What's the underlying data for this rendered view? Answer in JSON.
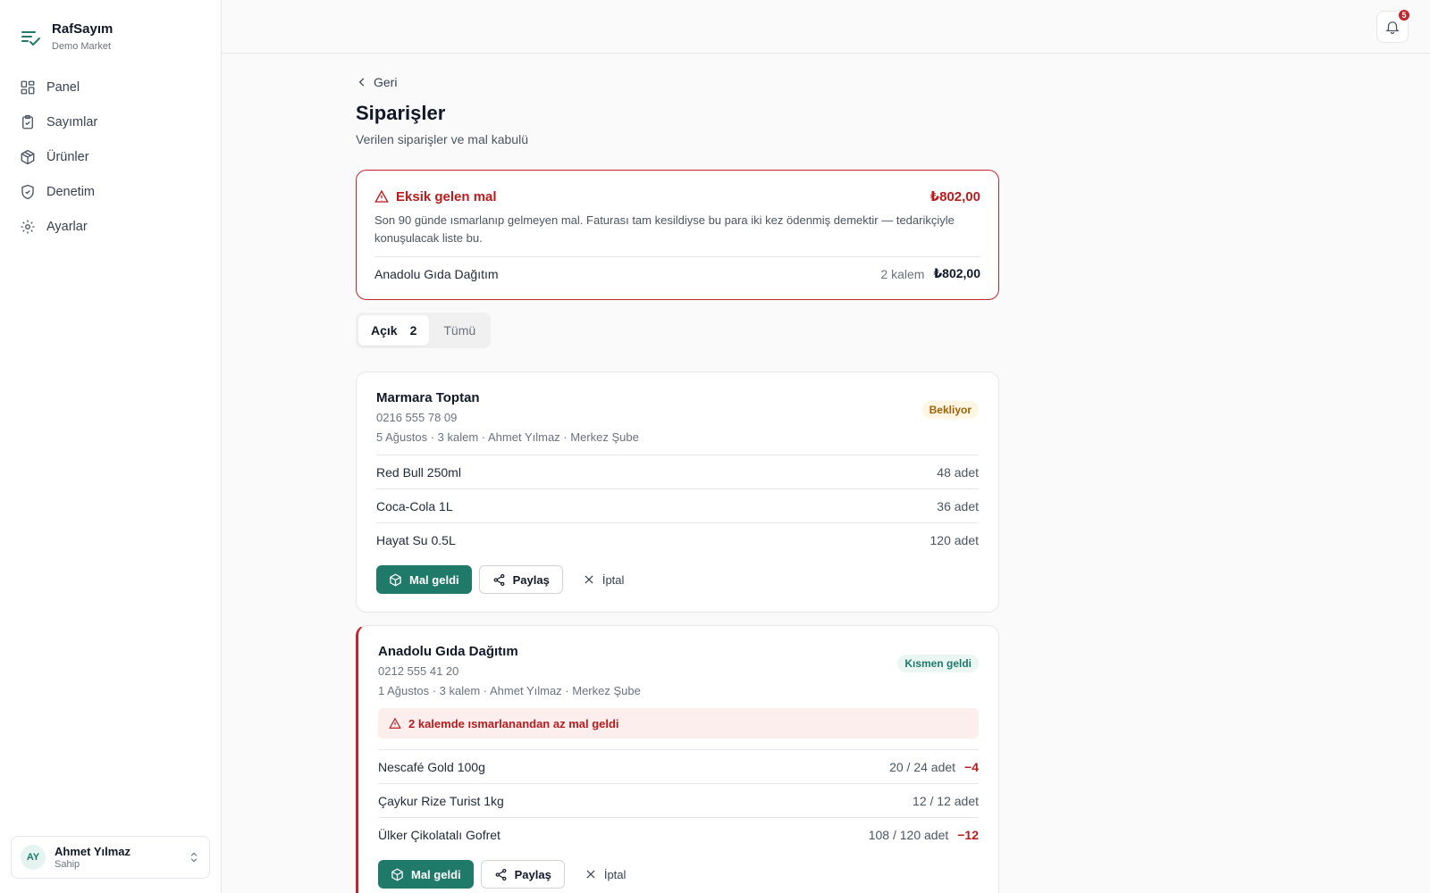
{
  "brand": {
    "name": "RafSayım",
    "subtitle": "Demo Market"
  },
  "nav": [
    {
      "label": "Panel",
      "icon": "grid-icon"
    },
    {
      "label": "Sayımlar",
      "icon": "clipboard-icon"
    },
    {
      "label": "Ürünler",
      "icon": "box-icon"
    },
    {
      "label": "Denetim",
      "icon": "shield-icon"
    },
    {
      "label": "Ayarlar",
      "icon": "gear-icon"
    }
  ],
  "user": {
    "initials": "AY",
    "name": "Ahmet Yılmaz",
    "role": "Sahip"
  },
  "notifications": {
    "count": "5"
  },
  "page": {
    "back": "Geri",
    "title": "Siparişler",
    "subtitle": "Verilen siparişler ve mal kabulü"
  },
  "alert": {
    "title": "Eksik gelen mal",
    "amount": "₺802,00",
    "description": "Son 90 günde ısmarlanıp gelmeyen mal. Faturası tam kesildiyse bu para iki kez ödenmiş demektir — tedarikçiyle konuşulacak liste bu.",
    "rows": [
      {
        "supplier": "Anadolu Gıda Dağıtım",
        "items": "2 kalem",
        "amount": "₺802,00"
      }
    ]
  },
  "tabs": [
    {
      "label": "Açık",
      "count": "2"
    },
    {
      "label": "Tümü",
      "count": ""
    }
  ],
  "orders": [
    {
      "supplier": "Marmara Toptan",
      "phone": "0216 555 78 09",
      "meta": "5 Ağustos · 3 kalem · Ahmet Yılmaz · Merkez Şube",
      "status": "Bekliyor",
      "warning": "",
      "lines": [
        {
          "name": "Red Bull 250ml",
          "qty": "48 adet",
          "diff": ""
        },
        {
          "name": "Coca-Cola 1L",
          "qty": "36 adet",
          "diff": ""
        },
        {
          "name": "Hayat Su 0.5L",
          "qty": "120 adet",
          "diff": ""
        }
      ]
    },
    {
      "supplier": "Anadolu Gıda Dağıtım",
      "phone": "0212 555 41 20",
      "meta": "1 Ağustos · 3 kalem · Ahmet Yılmaz · Merkez Şube",
      "status": "Kısmen geldi",
      "warning": "2 kalemde ısmarlanandan az mal geldi",
      "lines": [
        {
          "name": "Nescafé Gold 100g",
          "qty": "20 / 24 adet",
          "diff": "−4"
        },
        {
          "name": "Çaykur Rize Turist 1kg",
          "qty": "12 / 12 adet",
          "diff": ""
        },
        {
          "name": "Ülker Çikolatalı Gofret",
          "qty": "108 / 120 adet",
          "diff": "−12"
        }
      ]
    }
  ],
  "actions": {
    "received": "Mal geldi",
    "share": "Paylaş",
    "cancel": "İptal"
  },
  "colors": {
    "accent": "#1f7a6a",
    "danger": "#c0262d",
    "warning_bg": "#fdf6e3"
  }
}
